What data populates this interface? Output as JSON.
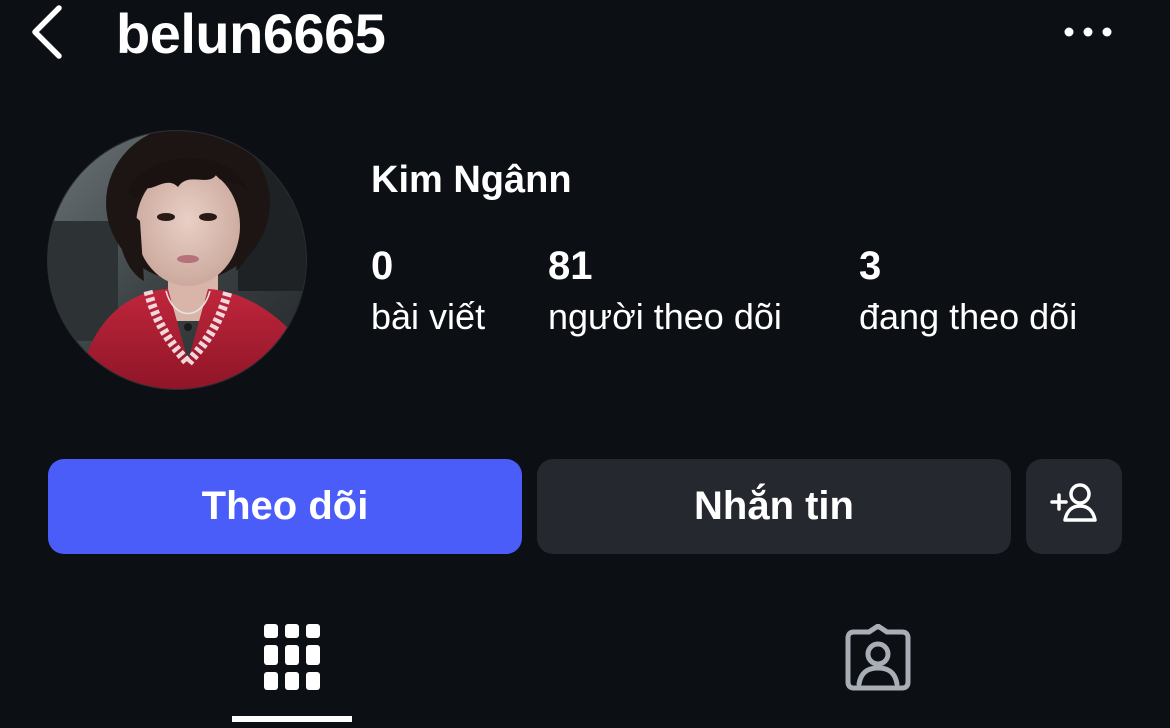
{
  "header": {
    "username": "belun6665",
    "back_icon": "chevron-left-icon",
    "more_icon": "more-horizontal-icon"
  },
  "profile": {
    "display_name": "Kim Ngânn",
    "avatar_icon": "avatar-photo",
    "stats": {
      "posts": {
        "count": "0",
        "label": "bài viết"
      },
      "followers": {
        "count": "81",
        "label": "người theo dõi"
      },
      "following": {
        "count": "3",
        "label": "đang theo dõi"
      }
    }
  },
  "actions": {
    "follow_label": "Theo dõi",
    "message_label": "Nhắn tin",
    "suggest_icon": "add-person-icon"
  },
  "tabs": {
    "grid_icon": "grid-icon",
    "tagged_icon": "tagged-person-icon",
    "active": "grid"
  },
  "colors": {
    "background": "#0c0f14",
    "follow_button": "#4a5df9",
    "secondary_button": "#25282e",
    "text": "#ffffff",
    "inactive_icon": "#a9adb5"
  }
}
